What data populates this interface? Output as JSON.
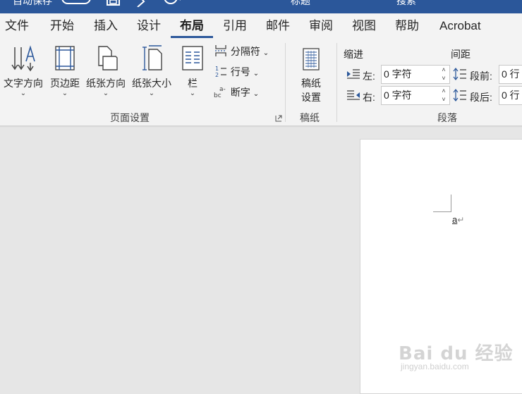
{
  "titlebar": {
    "autosave_label": "自动保存",
    "doc_name": "标题",
    "search_hint": "搜索"
  },
  "tabs": [
    {
      "label": "文件"
    },
    {
      "label": "开始"
    },
    {
      "label": "插入"
    },
    {
      "label": "设计"
    },
    {
      "label": "布局",
      "active": true
    },
    {
      "label": "引用"
    },
    {
      "label": "邮件"
    },
    {
      "label": "审阅"
    },
    {
      "label": "视图"
    },
    {
      "label": "帮助"
    },
    {
      "label": "Acrobat"
    }
  ],
  "ribbon": {
    "page_setup": {
      "text_direction": "文字方向",
      "margins": "页边距",
      "orientation": "纸张方向",
      "size": "纸张大小",
      "columns": "栏",
      "breaks": "分隔符",
      "line_numbers": "行号",
      "hyphenation": "断字",
      "group_label": "页面设置"
    },
    "manuscript": {
      "button": "稿纸",
      "button_line2": "设置",
      "group_label": "稿纸"
    },
    "paragraph": {
      "indent_header": "缩进",
      "spacing_header": "间距",
      "left_label": "左:",
      "left_value": "0 字符",
      "right_label": "右:",
      "right_value": "0 字符",
      "before_label": "段前:",
      "before_value": "0 行",
      "after_label": "段后:",
      "after_value": "0 行",
      "group_label": "段落"
    }
  },
  "document": {
    "text": "a",
    "paragraph_mark": "↵"
  },
  "watermark": {
    "brand": "Bai du 经验",
    "url": "jingyan.baidu.com"
  },
  "colors": {
    "title_bar": "#2b579a",
    "ribbon_bg": "#f3f3f3",
    "canvas_bg": "#e6e6e6",
    "accent": "#2b579a"
  }
}
